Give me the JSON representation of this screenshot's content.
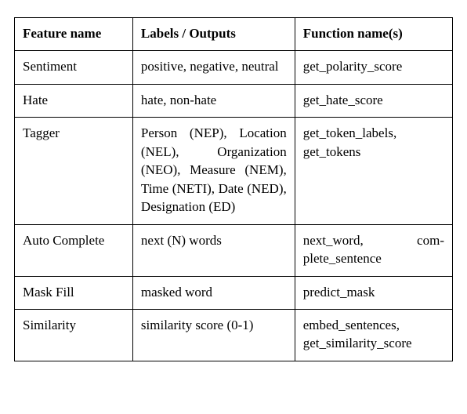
{
  "table": {
    "headers": {
      "feature": "Feature name",
      "labels": "Labels / Outputs",
      "functions": "Function name(s)"
    },
    "rows": [
      {
        "feature": "Sentiment",
        "labels": "positive, negative, neu­tral",
        "functions": "get_polarity_score"
      },
      {
        "feature": "Hate",
        "labels": "hate, non-hate",
        "functions": "get_hate_score"
      },
      {
        "feature": "Tagger",
        "labels": "Person (NEP), Loca­tion (NEL), Organiza­tion (NEO), Measure (NEM), Time (NETI), Date (NED), Designa­tion (ED)",
        "functions": "get_token_labels, get_tokens"
      },
      {
        "feature": "Auto Complete",
        "labels": "next (N) words",
        "functions_a": "next_word,",
        "functions_b": "com­plete_sentence"
      },
      {
        "feature": "Mask Fill",
        "labels": "masked word",
        "functions": "predict_mask"
      },
      {
        "feature": "Similarity",
        "labels": "similarity score (0-1)",
        "functions": "embed_sentences, get_similarity_score"
      }
    ]
  }
}
